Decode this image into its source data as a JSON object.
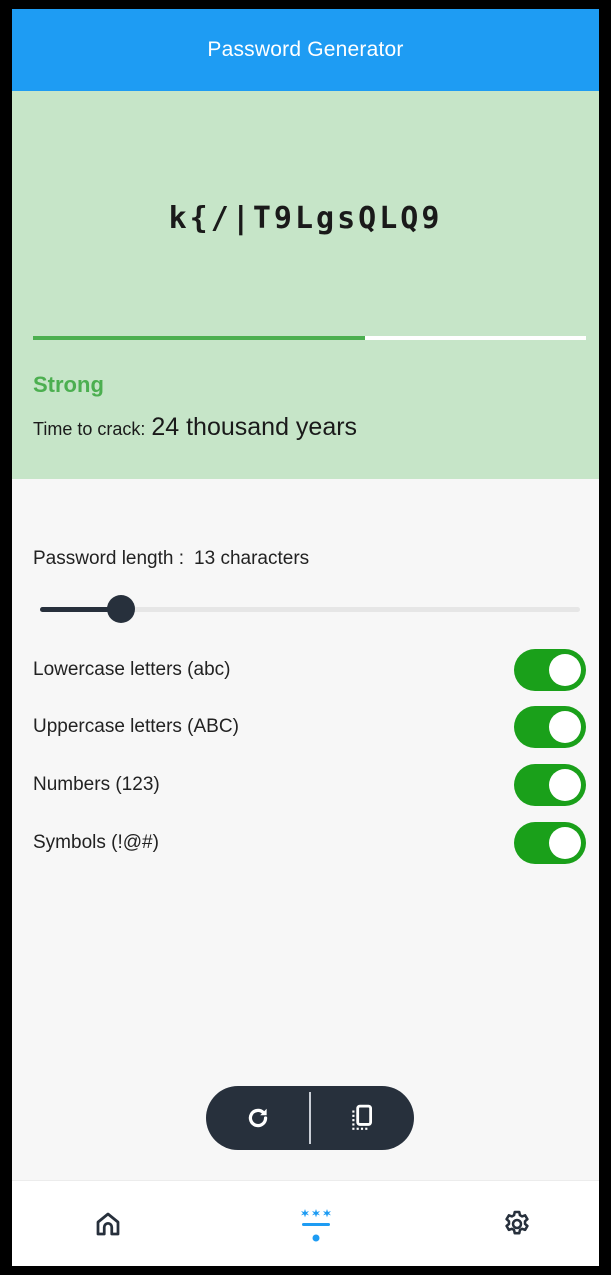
{
  "app": {
    "title": "Password Generator"
  },
  "result": {
    "password": "k{/|T9LgsQLQ9",
    "strength_label": "Strong",
    "strength_fraction": 0.6,
    "crack_label": "Time to crack:",
    "crack_value": "24 thousand years"
  },
  "length": {
    "label": "Password length :",
    "value": "13 characters",
    "slider_fraction": 0.15
  },
  "options": [
    {
      "label": "Lowercase letters (abc)",
      "enabled": true
    },
    {
      "label": "Uppercase letters (ABC)",
      "enabled": true
    },
    {
      "label": "Numbers (123)",
      "enabled": true
    },
    {
      "label": "Symbols (!@#)",
      "enabled": true
    }
  ],
  "actions": {
    "regenerate_icon": "refresh-icon",
    "copy_icon": "copy-icon"
  },
  "nav": {
    "items": [
      {
        "icon": "home-icon",
        "active": false
      },
      {
        "icon": "generator-icon",
        "active": true
      },
      {
        "icon": "gear-icon",
        "active": false
      }
    ]
  },
  "colors": {
    "app_bar": "#1e9cf3",
    "strength_panel": "#c6e5c8",
    "strength_accent": "#4caf50",
    "toggle_on": "#1aa01a",
    "dark_control": "#27303c",
    "nav_active": "#1e9cf3"
  }
}
